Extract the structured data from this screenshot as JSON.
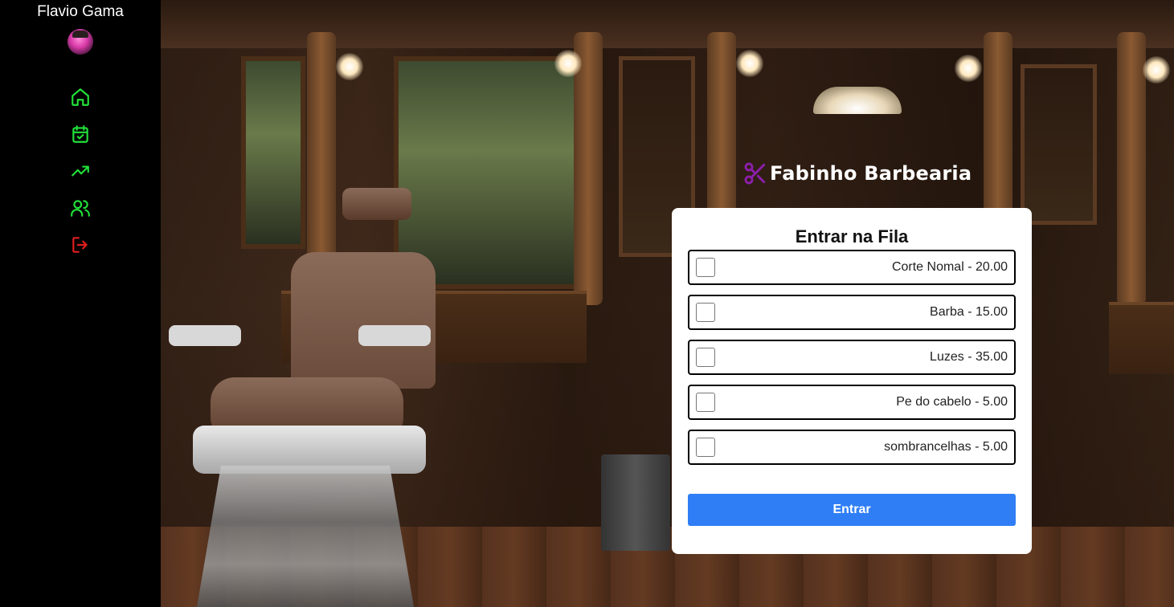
{
  "user": {
    "name": "Flavio Gama"
  },
  "nav": {
    "items": [
      {
        "icon": "home-icon",
        "color": "#22e03a"
      },
      {
        "icon": "calendar-check-icon",
        "color": "#22e03a"
      },
      {
        "icon": "trending-up-icon",
        "color": "#22e03a"
      },
      {
        "icon": "users-icon",
        "color": "#22e03a"
      },
      {
        "icon": "logout-icon",
        "color": "#e01e1e"
      }
    ]
  },
  "brand": {
    "name": "Fabinho Barbearia",
    "icon": "scissors-icon",
    "icon_color": "#8a1fa8"
  },
  "queue": {
    "title": "Entrar na Fila",
    "services": [
      {
        "label": "Corte Nomal - 20.00",
        "checked": false
      },
      {
        "label": "Barba - 15.00",
        "checked": false
      },
      {
        "label": "Luzes - 35.00",
        "checked": false
      },
      {
        "label": "Pe do cabelo - 5.00",
        "checked": false
      },
      {
        "label": "sombrancelhas - 5.00",
        "checked": false
      }
    ],
    "submit_label": "Entrar",
    "submit_color": "#2f7ef5"
  }
}
